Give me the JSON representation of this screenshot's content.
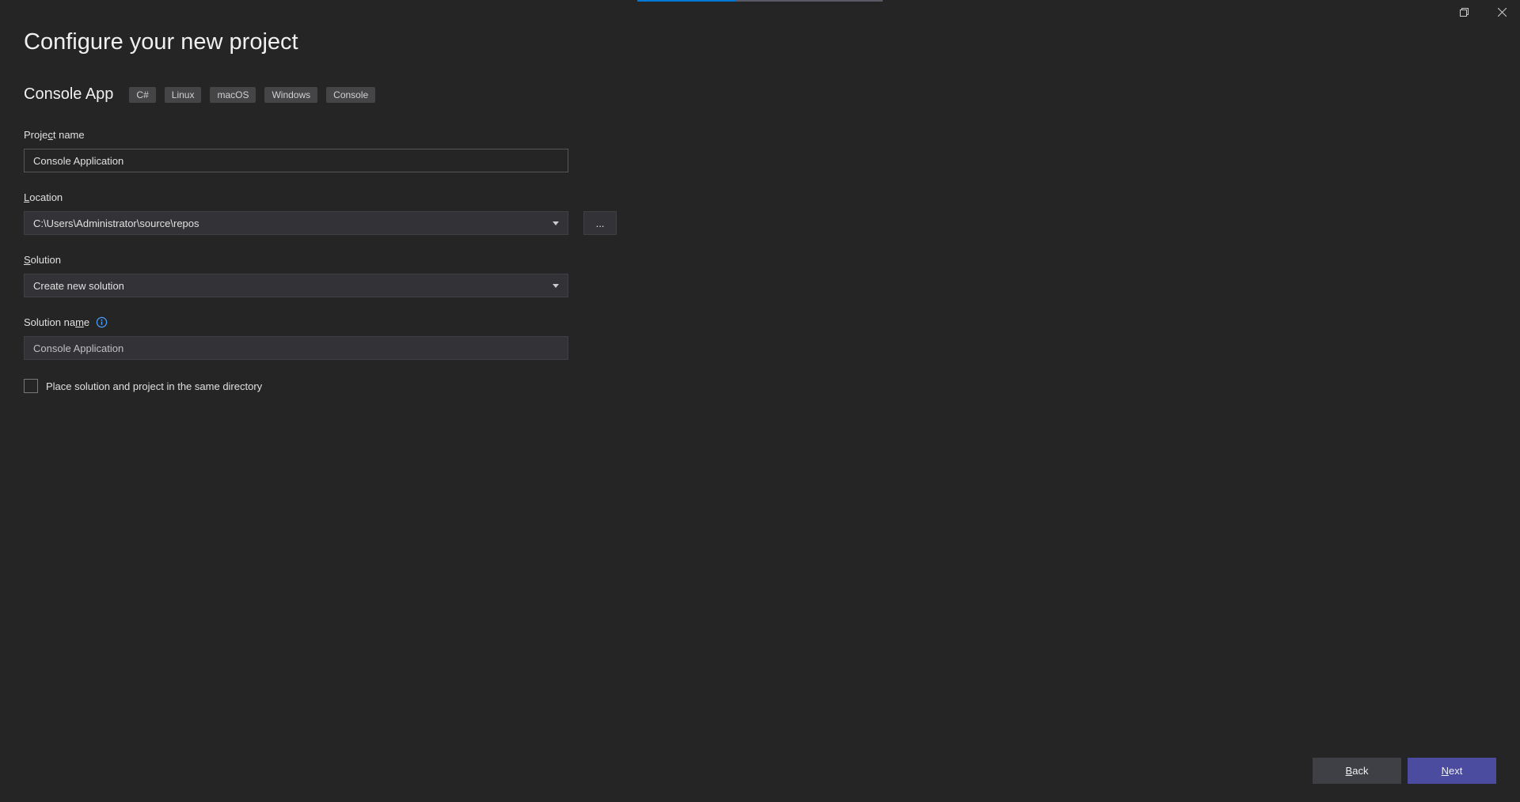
{
  "page": {
    "title": "Configure your new project"
  },
  "template": {
    "name": "Console App",
    "tags": [
      "C#",
      "Linux",
      "macOS",
      "Windows",
      "Console"
    ]
  },
  "form": {
    "project_name": {
      "label_prefix": "Proje",
      "label_underline": "c",
      "label_suffix": "t name",
      "value": "Console Application"
    },
    "location": {
      "label_underline": "L",
      "label_suffix": "ocation",
      "value": "C:\\Users\\Administrator\\source\\repos",
      "browse": "..."
    },
    "solution": {
      "label_underline": "S",
      "label_suffix": "olution",
      "value": "Create new solution"
    },
    "solution_name": {
      "label_prefix": "Solution na",
      "label_underline": "m",
      "label_suffix": "e",
      "value": "Console Application"
    },
    "same_dir": {
      "label_prefix": "Place solution and project in the same ",
      "label_underline": "d",
      "label_suffix": "irectory",
      "checked": false
    }
  },
  "footer": {
    "back": {
      "underline": "B",
      "suffix": "ack"
    },
    "next": {
      "underline": "N",
      "suffix": "ext"
    }
  }
}
